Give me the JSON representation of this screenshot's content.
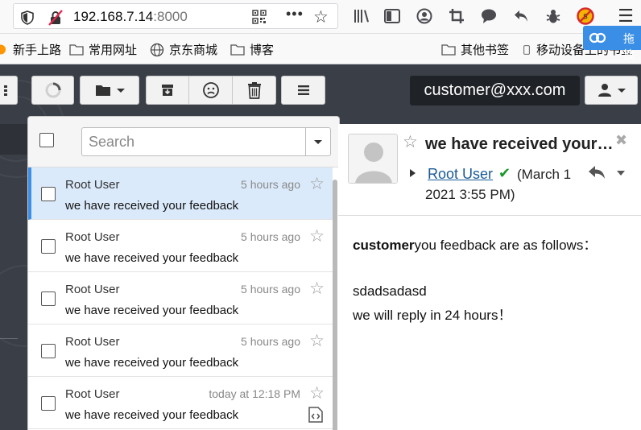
{
  "browser": {
    "url_host": "192.168.7.14",
    "url_port": ":8000",
    "bookmarks": [
      "新手上路",
      "常用网址",
      "京东商城",
      "博客"
    ],
    "bookmarks_right": [
      "其他书签",
      "移动设备上的书签"
    ],
    "extension_tab_label": "拖拽"
  },
  "toolbar": {
    "user_email": "customer@xxx.com"
  },
  "search": {
    "placeholder": "Search"
  },
  "messages": [
    {
      "sender": "Root User",
      "time": "5 hours ago",
      "subject": "we have received your feedback",
      "selected": true
    },
    {
      "sender": "Root User",
      "time": "5 hours ago",
      "subject": "we have received your feedback",
      "selected": false
    },
    {
      "sender": "Root User",
      "time": "5 hours ago",
      "subject": "we have received your feedback",
      "selected": false
    },
    {
      "sender": "Root User",
      "time": "5 hours ago",
      "subject": "we have received your feedback",
      "selected": false
    },
    {
      "sender": "Root User",
      "time": "today at 12:18 PM",
      "subject": "we have received your feedback",
      "selected": false,
      "has_attachment": true
    }
  ],
  "view": {
    "subject": "we have received your…",
    "from": "Root User",
    "date_line1": "(March 1",
    "date_line2": "2021 3:55 PM)",
    "body_bold": "customer",
    "body_line1_rest": "you feedback are as follows：",
    "body_line2": "sdadsadasd",
    "body_line3": "we will reply in 24 hours！"
  },
  "colors": {
    "app_background": "#3a3f47",
    "selected_row": "#dbeafb",
    "accent": "#3b8fe6",
    "link": "#1a5a96",
    "verified": "#1a9a2a"
  }
}
